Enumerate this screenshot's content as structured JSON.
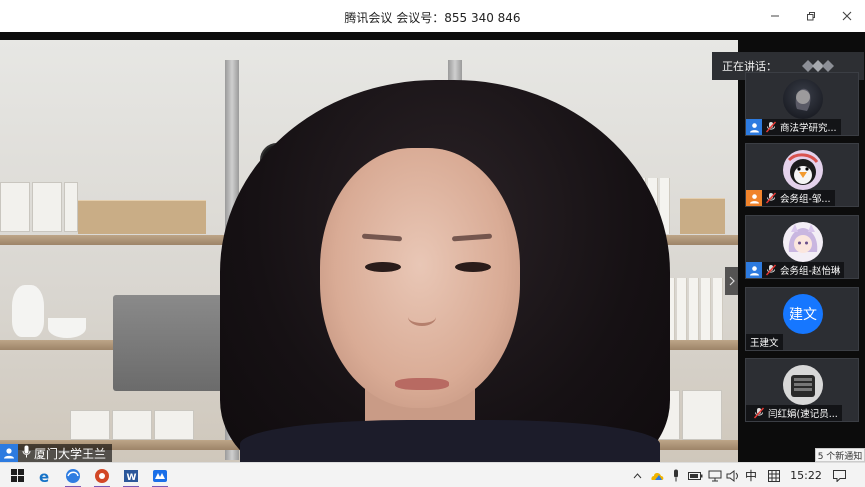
{
  "window": {
    "title": "腾讯会议 会议号：855 340 846"
  },
  "main_video": {
    "speaker_name": "厦门大学王兰"
  },
  "panel": {
    "speaking_label": "正在讲话：",
    "participants": [
      {
        "name": "商法学研究..."
      },
      {
        "name": "会务组-邹..."
      },
      {
        "name": "会务组-赵怡琳"
      },
      {
        "name": "王建文",
        "avatar_text": "建文"
      },
      {
        "name": "闫红娟(速记员..."
      }
    ]
  },
  "notification": {
    "text": "5 个新通知"
  },
  "taskbar": {
    "ime": "中",
    "clock": "15:22"
  },
  "colors": {
    "accent": "#2d7be0",
    "avatar_blue": "#1677ff"
  }
}
